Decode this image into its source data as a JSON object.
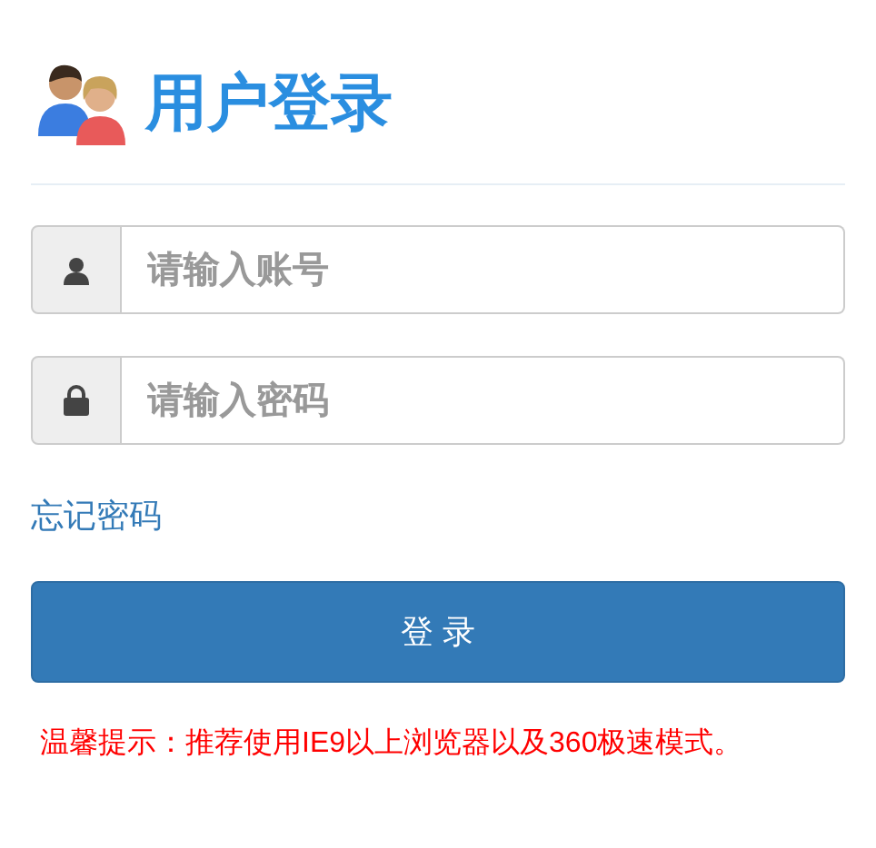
{
  "header": {
    "title": "用户登录"
  },
  "fields": [
    {
      "kind": "user",
      "placeholder": "请输入账号"
    },
    {
      "kind": "lock",
      "placeholder": "请输入密码"
    }
  ],
  "forgot_link": "忘记密码",
  "login_button": "登 录",
  "notice": "温馨提示：推荐使用IE9以上浏览器以及360极速模式。"
}
